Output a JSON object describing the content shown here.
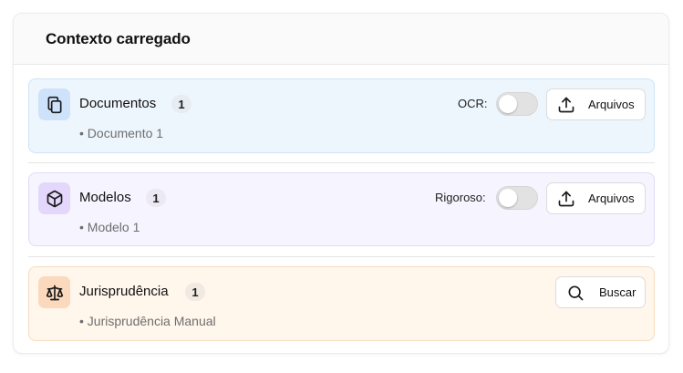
{
  "card": {
    "title": "Contexto carregado"
  },
  "sections": {
    "documentos": {
      "title": "Documentos",
      "count": "1",
      "icon": "copy-icon",
      "items": [
        "• Documento 1"
      ],
      "toggle": {
        "label": "OCR:",
        "on": false
      },
      "button": {
        "label": "Arquivos",
        "icon": "upload-icon"
      },
      "color": "#eef6fd"
    },
    "modelos": {
      "title": "Modelos",
      "count": "1",
      "icon": "box-icon",
      "items": [
        "• Modelo 1"
      ],
      "toggle": {
        "label": "Rigoroso:",
        "on": false
      },
      "button": {
        "label": "Arquivos",
        "icon": "upload-icon"
      },
      "color": "#f6f4fe"
    },
    "jurisprudencia": {
      "title": "Jurisprudência",
      "count": "1",
      "icon": "scale-icon",
      "items": [
        "• Jurisprudência Manual"
      ],
      "button": {
        "label": "Buscar",
        "icon": "search-icon"
      },
      "color": "#fff6ec"
    }
  }
}
